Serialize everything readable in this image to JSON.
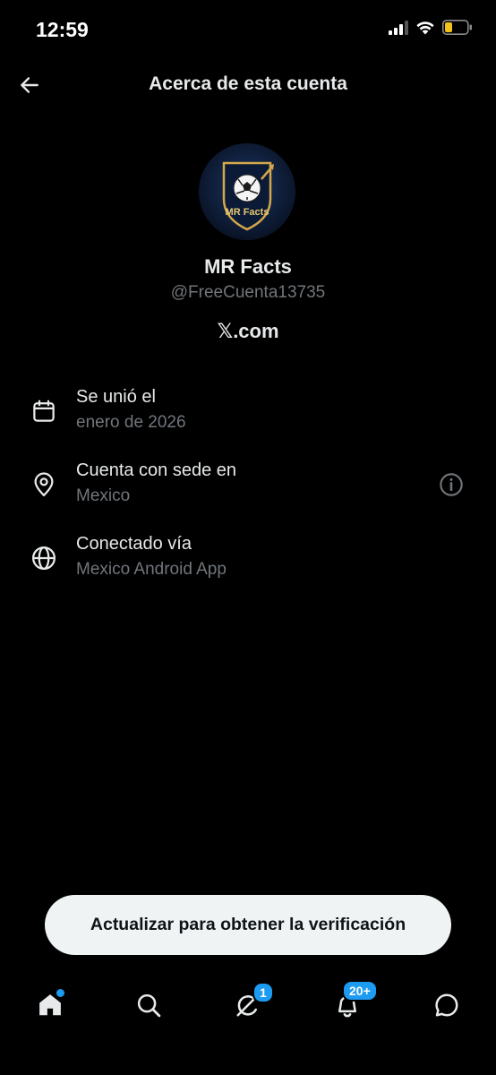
{
  "status_bar": {
    "time": "12:59"
  },
  "header": {
    "title": "Acerca de esta cuenta",
    "back_icon": "arrow-left-icon"
  },
  "profile": {
    "avatar_text": "MR Facts",
    "name": "MR Facts",
    "handle": "@FreeCuenta13735",
    "platform": ".com"
  },
  "info": [
    {
      "icon": "calendar-icon",
      "label": "Se unió el",
      "value": "enero de 2026"
    },
    {
      "icon": "location-pin-icon",
      "label": "Cuenta con sede en",
      "value": "Mexico"
    },
    {
      "icon": "globe-icon",
      "label": "Conectado vía",
      "value": "Mexico Android App"
    }
  ],
  "cta": {
    "label": "Actualizar para obtener la verificación"
  },
  "nav": {
    "items": [
      "home-icon",
      "search-icon",
      "grok-icon",
      "notifications-icon",
      "messages-icon"
    ],
    "grok_badge": "1",
    "notifications_badge": "20+"
  },
  "colors": {
    "background": "#000000",
    "text": "#e7e9ea",
    "muted": "#71767b",
    "accent": "#1d9bf0",
    "button_bg": "#eff3f4"
  }
}
